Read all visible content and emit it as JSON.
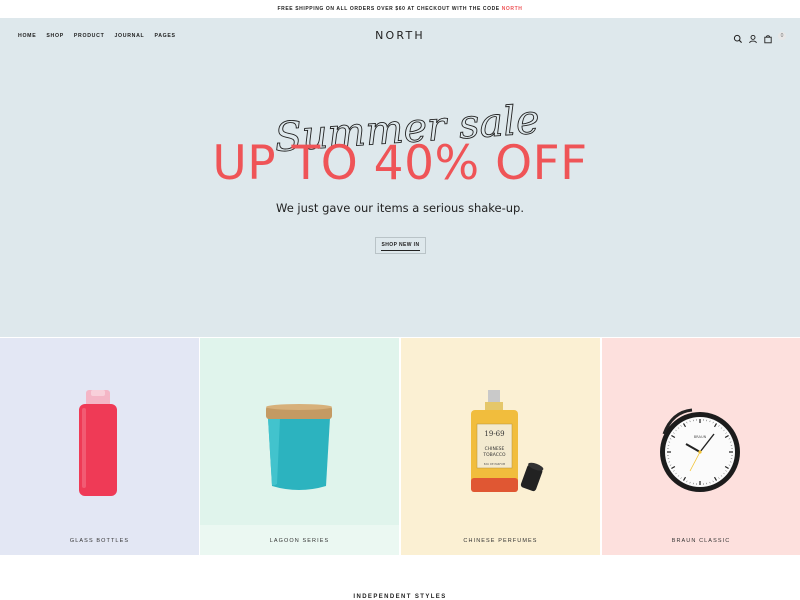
{
  "announcement": {
    "text": "FREE SHIPPING ON ALL ORDERS OVER $60 AT CHECKOUT WITH THE CODE",
    "code": "NORTH"
  },
  "nav": {
    "items": [
      "HOME",
      "SHOP",
      "PRODUCT",
      "JOURNAL",
      "PAGES"
    ]
  },
  "header": {
    "logo": "NORTH",
    "cart_count": "0"
  },
  "hero": {
    "script_text": "Summer sale",
    "headline": "UP TO 40% OFF",
    "subheading": "We just gave our items a serious shake-up.",
    "button_label": "SHOP NEW IN",
    "background": "#dee8ec",
    "accent": "#ef5457"
  },
  "categories": [
    {
      "label": "GLASS BOTTLES",
      "background": "#e3e7f4"
    },
    {
      "label": "LAGOON SERIES",
      "background": "#e0f4ec"
    },
    {
      "label": "CHINESE PERFUMES",
      "background": "#fbf0d3"
    },
    {
      "label": "BRAUN CLASSIC",
      "background": "#fde0dd"
    }
  ],
  "products": {
    "perfume_label_number": "19-69",
    "perfume_label_name_1": "CHINESE",
    "perfume_label_name_2": "TOBACCO",
    "perfume_label_small": "EAU DE PARFUM",
    "clock_brand": "BRAUN"
  },
  "sections": {
    "independent_title": "INDEPENDENT STYLES"
  }
}
